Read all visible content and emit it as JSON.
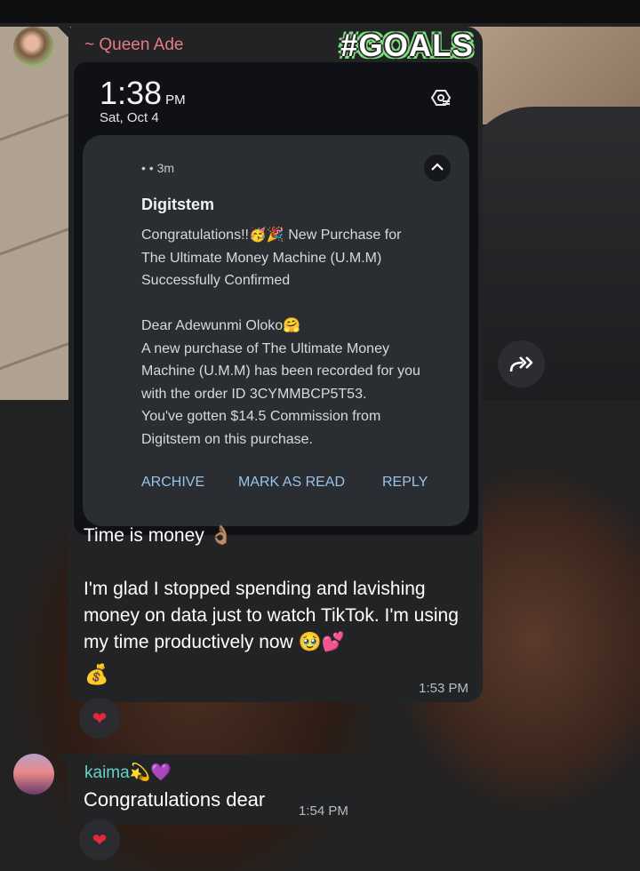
{
  "chat": {
    "messages": [
      {
        "sender": "~ Queen Ade",
        "sticker_text": "#GOALS",
        "screenshot": {
          "time": "1:38",
          "ampm": "PM",
          "date": "Sat, Oct 4",
          "notification": {
            "meta": "• • 3m",
            "app": "Digitstem",
            "body": "Congratulations!!🥳🎉 New Purchase for\nThe Ultimate Money Machine (U.M.M)\nSuccessfully Confirmed\n\nDear Adewunmi Oloko🤗\nA new purchase of The Ultimate Money\nMachine (U.M.M) has been recorded for you\nwith the order ID 3CYMMBCP5T53.\nYou've gotten  $14.5 Commission from\nDigitstem on this purchase.",
            "actions": [
              "ARCHIVE",
              "MARK AS READ",
              "REPLY"
            ]
          }
        },
        "text": "Time is money 👌🏽\n\nI'm glad I stopped spending and lavishing money on data just to watch TikTok. I'm using my time productively now 🥹💕",
        "extra_emoji": "💰",
        "time": "1:53 PM",
        "reaction": "❤"
      },
      {
        "sender": "kaima💫💜",
        "text": "Congratulations dear",
        "time": "1:54 PM",
        "reaction": "❤"
      }
    ]
  },
  "icons": {
    "forward": "forward-icon",
    "settings": "notification-settings-icon",
    "collapse": "chevron-up-icon"
  },
  "colors": {
    "bubble": "#212325",
    "queen_name": "#e87a88",
    "kaima_name": "#67d1c8",
    "action_text": "#9bc3ea"
  }
}
